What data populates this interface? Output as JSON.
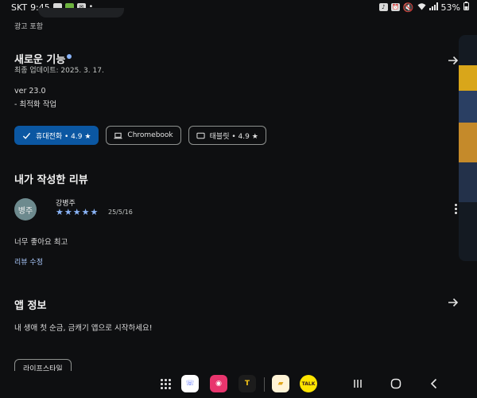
{
  "status_bar": {
    "carrier": "SKT",
    "time": "9:45",
    "battery": "53%"
  },
  "ad_label": "광고 포함",
  "whats_new": {
    "title": "새로운 기능",
    "updated": "최종 업데이트: 2025. 3. 17.",
    "version": "ver 23.0",
    "notes": "- 최적화 작업"
  },
  "device_chips": [
    {
      "label": "휴대전화 • 4.9 ★",
      "selected": true,
      "icon": "check-icon"
    },
    {
      "label": "Chromebook",
      "selected": false,
      "icon": "laptop-icon"
    },
    {
      "label": "태블릿 • 4.9 ★",
      "selected": false,
      "icon": "tablet-icon"
    }
  ],
  "my_review": {
    "title": "내가 작성한 리뷰",
    "avatar_text": "병주",
    "reviewer_name": "강병주",
    "rating": 5,
    "date": "25/5/16",
    "text": "너무 좋아요 최고",
    "edit_label": "리뷰 수정"
  },
  "app_info": {
    "title": "앱 정보",
    "description": "내 생애 첫 순금, 금캐기 앱으로 시작하세요!",
    "category": "라이프스타일"
  },
  "taskbar_apps": [
    {
      "name": "phone-app-icon",
      "glyph": "☏",
      "bg": "#ffffff",
      "fg": "#3d5afe"
    },
    {
      "name": "camera-app-icon",
      "glyph": "◉",
      "bg": "#e8356d",
      "fg": "#ffffff"
    },
    {
      "name": "tmap-app-icon",
      "glyph": "T",
      "bg": "#1c1c1c",
      "fg": "#f5c518"
    },
    {
      "name": "gold-app-icon",
      "glyph": "▰",
      "bg": "#fff4d6",
      "fg": "#e0a81c"
    },
    {
      "name": "kakaotalk-app-icon",
      "glyph": "TALK",
      "bg": "#fee500",
      "fg": "#3b1e1e"
    }
  ],
  "colors": {
    "accent": "#8ab4f8",
    "selected_chip": "#0b57a2",
    "background": "#0e0f11"
  }
}
